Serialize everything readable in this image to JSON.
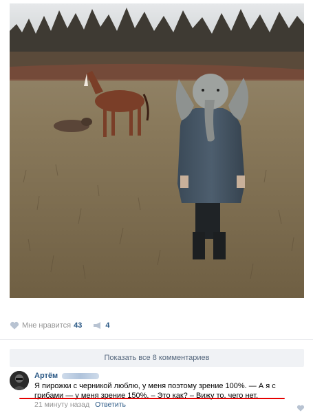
{
  "post": {
    "likes_label": "Мне нравится",
    "likes_count": "43",
    "reposts_count": "4"
  },
  "comments": {
    "show_all_label": "Показать все 8 комментариев"
  },
  "comment": {
    "author": "Артём",
    "text_line1": "Я пирожки с черникой люблю, у меня поэтому зрение 100%. — А я с",
    "text_line2": "грибами — у меня зрение 150%. – Это как? – Вижу то, чего нет.",
    "time": "21 минуту назад",
    "reply_label": "Ответить"
  },
  "icons": {
    "like": "heart-icon",
    "repost": "megaphone-icon",
    "comment_like": "heart-icon"
  },
  "colors": {
    "link": "#2a5885",
    "muted": "#939393",
    "underline": "#e60000",
    "button_bg": "#f0f2f5"
  }
}
